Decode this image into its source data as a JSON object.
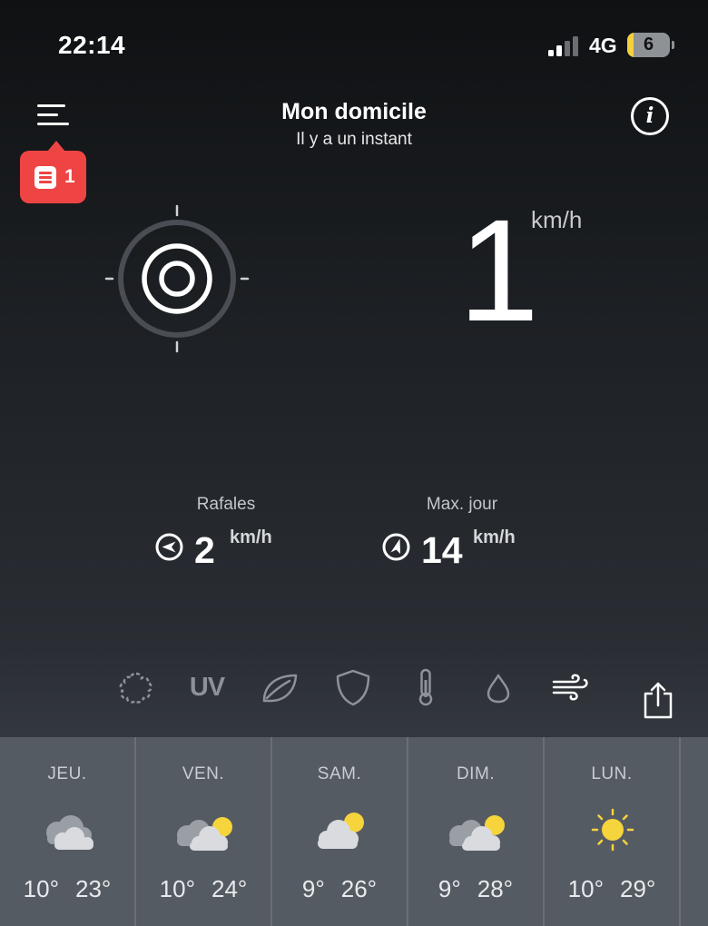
{
  "status_bar": {
    "time": "22:14",
    "network": "4G",
    "battery_level": "6",
    "battery_color": "#f3d13c"
  },
  "header": {
    "title": "Mon domicile",
    "subtitle": "Il y a un instant",
    "menu_icon": "hamburger-menu-icon",
    "info_icon": "info-icon",
    "notification_count": "1",
    "notification_color": "#ef4444"
  },
  "wind": {
    "speed": "1",
    "unit": "km/h"
  },
  "stats": {
    "gusts": {
      "label": "Rafales",
      "value": "2",
      "unit": "km/h"
    },
    "day_max": {
      "label": "Max. jour",
      "value": "14",
      "unit": "km/h"
    }
  },
  "icon_bar": {
    "uv_label": "UV",
    "items": [
      "pollen-icon",
      "uv-icon",
      "leaf-icon",
      "shield-icon",
      "thermometer-icon",
      "drop-icon",
      "wind-icon"
    ],
    "active": "wind-icon",
    "share_icon": "share-icon"
  },
  "forecast": [
    {
      "day": "JEU.",
      "icon": "cloudy",
      "min": "10°",
      "max": "23°"
    },
    {
      "day": "VEN.",
      "icon": "partly-cloudy",
      "min": "10°",
      "max": "24°"
    },
    {
      "day": "SAM.",
      "icon": "partly-cloudy",
      "min": "9°",
      "max": "26°"
    },
    {
      "day": "DIM.",
      "icon": "partly-cloudy",
      "min": "9°",
      "max": "28°"
    },
    {
      "day": "LUN.",
      "icon": "sunny",
      "min": "10°",
      "max": "29°"
    }
  ]
}
